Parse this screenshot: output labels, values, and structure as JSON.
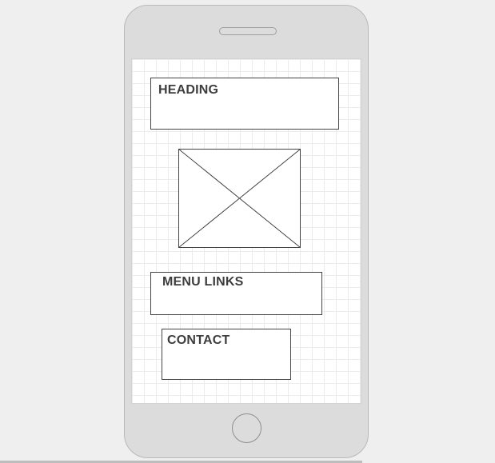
{
  "wireframe": {
    "heading_label": "HEADING",
    "menu_links_label": "MENU LINKS",
    "contact_label": "CONTACT",
    "image_placeholder_icon": "image-placeholder-icon",
    "colors": {
      "background": "#efefef",
      "device_body": "#dcdcdc",
      "screen": "#ffffff",
      "grid_line": "#ececec",
      "box_border": "#444444",
      "label_text": "#3d3d3d"
    }
  }
}
